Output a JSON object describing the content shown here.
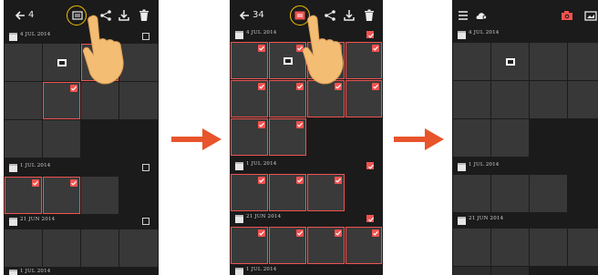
{
  "panels": [
    {
      "toolbar": {
        "count": "4",
        "accent_icon": "select-all-icon"
      },
      "sections": [
        {
          "date": "4 JUL 2014"
        },
        {
          "date": "1 JUL 2014"
        },
        {
          "date": "21 JUN 2014"
        },
        {
          "date": "1 JUL 2014"
        }
      ]
    },
    {
      "toolbar": {
        "count": "34",
        "accent_icon": "select-all-icon"
      },
      "sections": [
        {
          "date": "4 JUL 2014"
        },
        {
          "date": "1 JUL 2014"
        },
        {
          "date": "21 JUN 2014"
        },
        {
          "date": "1 JUL 2014"
        }
      ]
    },
    {
      "toolbar": {
        "count": "",
        "accent_icon": "camera-icon"
      },
      "sections": [
        {
          "date": "4 JUL 2014"
        },
        {
          "date": "1 JUL 2014"
        },
        {
          "date": "21 JUN 2014"
        }
      ]
    }
  ],
  "colors": {
    "accent": "#ef5350",
    "background": "#1b1b1b",
    "tile": "#383838",
    "arrow": "#e8542b",
    "highlight": "#f2c200"
  }
}
